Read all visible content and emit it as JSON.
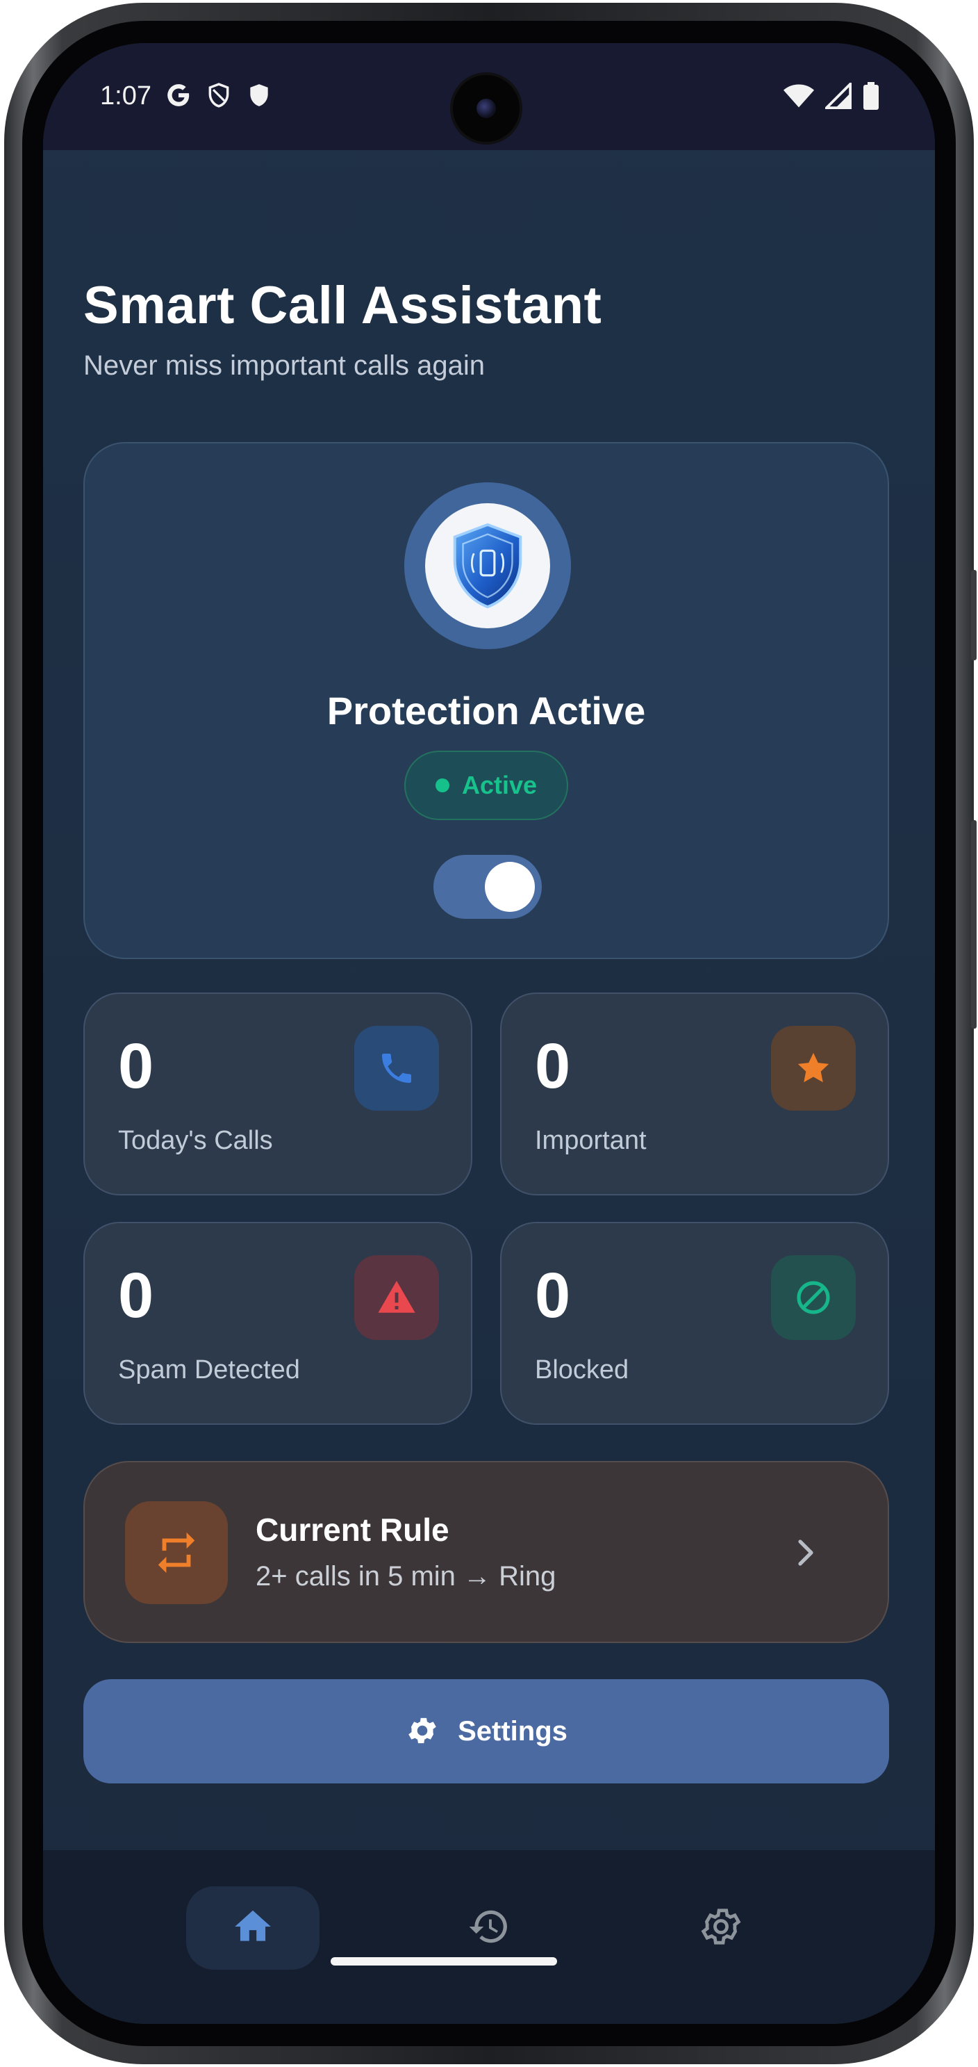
{
  "status_bar": {
    "time": "1:07",
    "left_icons": [
      "google-icon",
      "shield-outline-icon",
      "shield-filled-icon"
    ],
    "right_icons": [
      "wifi-icon",
      "signal-icon",
      "battery-icon"
    ]
  },
  "header": {
    "title": "Smart Call Assistant",
    "subtitle": "Never miss important calls again"
  },
  "protection": {
    "title": "Protection Active",
    "status_badge": "Active",
    "toggle_on": true,
    "icon": "shield-icon"
  },
  "stats": [
    {
      "value": "0",
      "label": "Today's Calls",
      "icon": "phone-icon",
      "color": "#3c7ee0"
    },
    {
      "value": "0",
      "label": "Important",
      "icon": "star-icon",
      "color": "#f07f2a"
    },
    {
      "value": "0",
      "label": "Spam Detected",
      "icon": "warning-icon",
      "color": "#e8484e"
    },
    {
      "value": "0",
      "label": "Blocked",
      "icon": "block-icon",
      "color": "#17b58a"
    }
  ],
  "current_rule": {
    "title": "Current Rule",
    "description": "2+ calls in 5 min → Ring",
    "icon": "repeat-icon"
  },
  "settings_button": {
    "label": "Settings",
    "icon": "gear-icon"
  },
  "bottom_nav": [
    {
      "icon": "home-icon",
      "active": true
    },
    {
      "icon": "history-icon",
      "active": false
    },
    {
      "icon": "settings-icon",
      "active": false
    }
  ],
  "colors": {
    "background": "#1f3147",
    "accent": "#4a6aa1",
    "active_green": "#16c08a"
  }
}
